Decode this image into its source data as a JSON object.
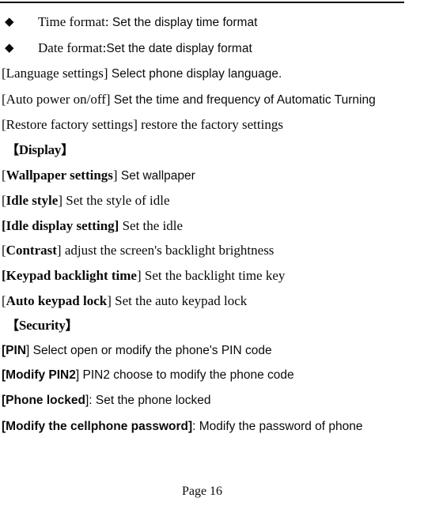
{
  "document": {
    "page_label": "Page 16",
    "bullet_glyph": "◆",
    "bracket_open": "[",
    "bracket_close": "]",
    "lenticular_open": "【",
    "lenticular_close": "】"
  },
  "bullets": [
    {
      "term": "Time format:",
      "description": "Set the display time format"
    },
    {
      "term": "Date format:",
      "description": "Set the date display format"
    }
  ],
  "entries_intro": [
    {
      "label": "Language settings",
      "description": "Select phone display language."
    },
    {
      "label": "Auto power on/off",
      "description": "Set the time and frequency of Automatic Turning"
    },
    {
      "label": "Restore factory settings",
      "description": "restore the factory settings"
    }
  ],
  "sections": [
    {
      "heading": "Display",
      "entries": [
        {
          "label": "Wallpaper settings",
          "separator": "",
          "description": "Set wallpaper"
        },
        {
          "label": "Idle style",
          "separator": "",
          "description": "Set the style of idle"
        },
        {
          "label": "Idle display setting",
          "separator": "",
          "description": "Set the idle"
        },
        {
          "label": "Contrast",
          "separator": "",
          "description": "adjust the screen's backlight brightness"
        },
        {
          "label": "Keypad backlight time",
          "separator": "",
          "description": "Set the backlight time key"
        },
        {
          "label": "Auto keypad lock",
          "separator": "",
          "description": "Set the auto keypad lock"
        }
      ]
    },
    {
      "heading": "Security",
      "entries": [
        {
          "label": "PIN",
          "separator": "",
          "description": "Select open or modify the phone's PIN code"
        },
        {
          "label": "Modify PIN2",
          "separator": "",
          "description": "PIN2 choose to modify the phone code"
        },
        {
          "label": "Phone locked",
          "separator": ":",
          "description": "Set the phone locked"
        },
        {
          "label": "Modify the cellphone password",
          "separator": ":",
          "description": "Modify the password of phone"
        }
      ]
    }
  ]
}
